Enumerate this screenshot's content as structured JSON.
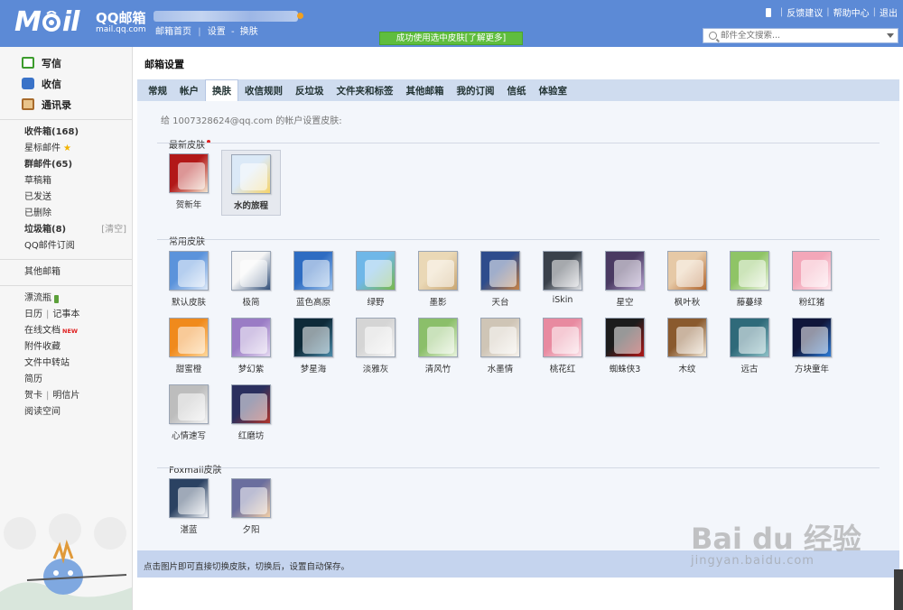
{
  "logo": {
    "mark": "M",
    "mark_rest": "il",
    "title": "QQ邮箱",
    "url": "mail.qq.com"
  },
  "top_nav": {
    "home": "邮箱首页",
    "separator": "|",
    "settings": "设置",
    "dash": "-",
    "skin": "换肤"
  },
  "top_links": {
    "feedback": "反馈建议",
    "help": "帮助中心",
    "logout": "退出",
    "separator": "|"
  },
  "notice": "成功使用选中皮肤[了解更多]",
  "search": {
    "placeholder": "邮件全文搜索..."
  },
  "sidebar": {
    "quick": [
      {
        "label": "写信",
        "icon": "write-icon"
      },
      {
        "label": "收信",
        "icon": "inbox-icon"
      },
      {
        "label": "通讯录",
        "icon": "contacts-icon"
      }
    ],
    "folders": [
      {
        "label": "收件箱(168)"
      },
      {
        "label": "星标邮件"
      },
      {
        "label": "群邮件(65)"
      },
      {
        "label": "草稿箱"
      },
      {
        "label": "已发送"
      },
      {
        "label": "已删除"
      },
      {
        "label": "垃圾箱(8)",
        "extra": "[清空]"
      },
      {
        "label": "QQ邮件订阅"
      }
    ],
    "other": "其他邮箱",
    "apps": [
      {
        "label": "漂流瓶"
      },
      {
        "label": "日历",
        "label2": "记事本"
      },
      {
        "label": "在线文档",
        "badge": "NEW"
      },
      {
        "label": "附件收藏"
      },
      {
        "label": "文件中转站"
      },
      {
        "label": "简历"
      },
      {
        "label": "贺卡",
        "label2": "明信片"
      },
      {
        "label": "阅读空间"
      }
    ],
    "separator": "|"
  },
  "main": {
    "title": "邮箱设置",
    "tabs": [
      "常规",
      "帐户",
      "换肤",
      "收信规则",
      "反垃圾",
      "文件夹和标签",
      "其他邮箱",
      "我的订阅",
      "信纸",
      "体验室"
    ],
    "active_tab": "换肤",
    "intro": "给 1007328624@qq.com 的帐户设置皮肤:",
    "sections": {
      "latest": "最新皮肤",
      "common": "常用皮肤",
      "foxmail": "Foxmail皮肤"
    },
    "latest_skins": [
      {
        "name": "贺新年",
        "colors": [
          "#b21818",
          "#f4e6d0"
        ]
      },
      {
        "name": "水的旅程",
        "colors": [
          "#dbe9f7",
          "#f6d46a"
        ],
        "selected": true
      }
    ],
    "common_skins": [
      {
        "name": "默认皮肤",
        "colors": [
          "#5b93db",
          "#dde9f8"
        ]
      },
      {
        "name": "极简",
        "colors": [
          "#f5f5f5",
          "#2f4d78"
        ]
      },
      {
        "name": "蓝色高原",
        "colors": [
          "#2e6cc2",
          "#9cc2eb"
        ]
      },
      {
        "name": "绿野",
        "colors": [
          "#6fb7e8",
          "#79b84a"
        ]
      },
      {
        "name": "墨影",
        "colors": [
          "#ead8b6",
          "#c9a672"
        ]
      },
      {
        "name": "天台",
        "colors": [
          "#2e4c8c",
          "#c88244"
        ]
      },
      {
        "name": "iSkin",
        "colors": [
          "#3a414b",
          "#e2e4e8"
        ]
      },
      {
        "name": "星空",
        "colors": [
          "#4a3a62",
          "#b8a4d2"
        ]
      },
      {
        "name": "枫叶秋",
        "colors": [
          "#e6c9a6",
          "#b0632b"
        ]
      },
      {
        "name": "藤蔓绿",
        "colors": [
          "#8fc466",
          "#eef5e4"
        ]
      },
      {
        "name": "粉红猪",
        "colors": [
          "#f3a7b9",
          "#fde8ee"
        ]
      },
      {
        "name": "甜蜜橙",
        "colors": [
          "#f08a1c",
          "#ffd79a"
        ]
      },
      {
        "name": "梦幻紫",
        "colors": [
          "#9a7cc5",
          "#e4d8f0"
        ]
      },
      {
        "name": "梦星海",
        "colors": [
          "#0e2a38",
          "#4a8aa8"
        ]
      },
      {
        "name": "淡雅灰",
        "colors": [
          "#d5d5d5",
          "#f4f4f4"
        ]
      },
      {
        "name": "清风竹",
        "colors": [
          "#8bbf6a",
          "#e8f3dc"
        ]
      },
      {
        "name": "水墨情",
        "colors": [
          "#cfc5b6",
          "#f6f2ec"
        ]
      },
      {
        "name": "桃花红",
        "colors": [
          "#e88aa0",
          "#fbe4ea"
        ]
      },
      {
        "name": "蜘蛛侠3",
        "colors": [
          "#1c1c1c",
          "#b01818"
        ]
      },
      {
        "name": "木纹",
        "colors": [
          "#8a5a2e",
          "#f1e7d6"
        ]
      },
      {
        "name": "远古",
        "colors": [
          "#2f6a7a",
          "#8cc0c6"
        ]
      },
      {
        "name": "方块童年",
        "colors": [
          "#10163a",
          "#2c7bd6"
        ]
      },
      {
        "name": "心情速写",
        "colors": [
          "#bdbdbd",
          "#f2f2f2"
        ]
      },
      {
        "name": "红磨坊",
        "colors": [
          "#2a2f5e",
          "#b0352c"
        ]
      }
    ],
    "foxmail_skins": [
      {
        "name": "湛蓝",
        "colors": [
          "#2b4262",
          "#f4f6f9"
        ]
      },
      {
        "name": "夕阳",
        "colors": [
          "#6a6e9e",
          "#f2cfa8"
        ]
      }
    ],
    "footer": "点击图片即可直接切换皮肤，切换后，设置自动保存。"
  },
  "watermark": {
    "main": "Bai du 经验",
    "sub": "jingyan.baidu.com"
  }
}
